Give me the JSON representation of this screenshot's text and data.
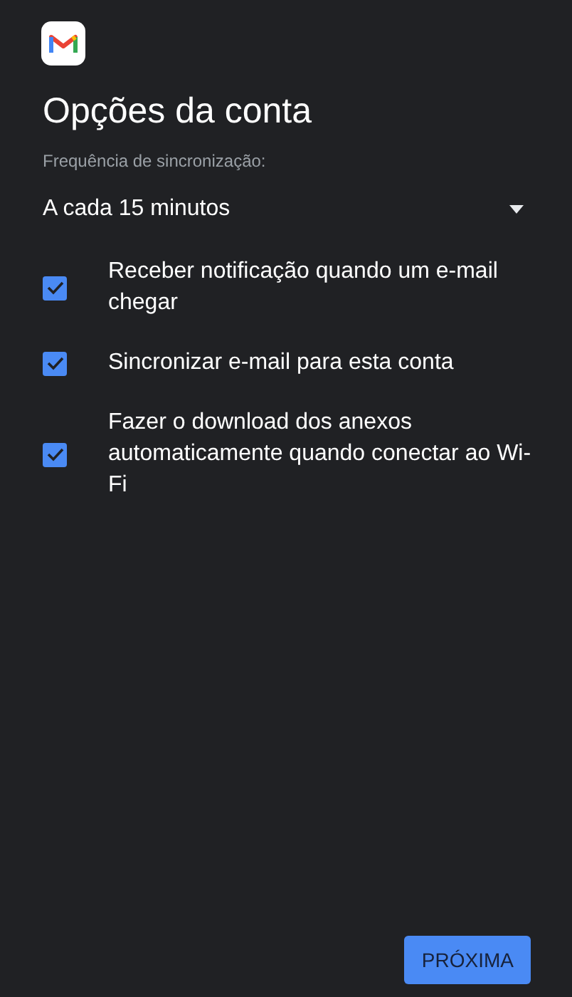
{
  "title": "Opções da conta",
  "sync_frequency": {
    "label": "Frequência de sincronização:",
    "value": "A cada 15 minutos"
  },
  "options": [
    {
      "label": "Receber notificação quando um e-mail chegar",
      "checked": true
    },
    {
      "label": "Sincronizar e-mail para esta conta",
      "checked": true
    },
    {
      "label": "Fazer o download dos anexos automaticamente quando conectar ao Wi-Fi",
      "checked": true
    }
  ],
  "next_button": "PRÓXIMA"
}
